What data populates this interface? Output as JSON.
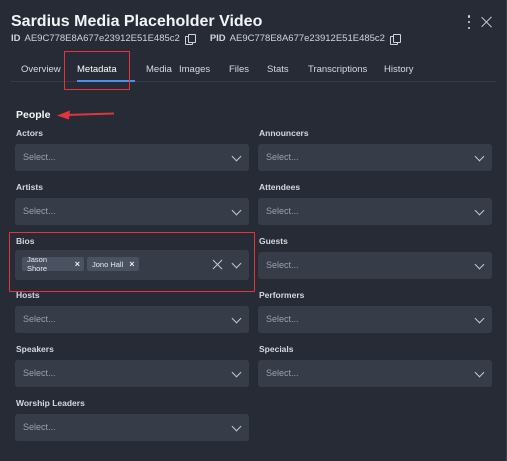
{
  "header": {
    "title": "Sardius Media Placeholder Video",
    "id_label": "ID",
    "id_value": "AE9C778E8A677e23912E51E485c2",
    "pid_label": "PID",
    "pid_value": "AE9C778E8A677e23912E51E485c2"
  },
  "tabs": [
    {
      "label": "Overview"
    },
    {
      "label": "Metadata"
    },
    {
      "label": "Media"
    },
    {
      "label": "Images"
    },
    {
      "label": "Files"
    },
    {
      "label": "Stats"
    },
    {
      "label": "Transcriptions"
    },
    {
      "label": "History"
    }
  ],
  "active_tab": "Metadata",
  "section_title": "People",
  "placeholder": "Select...",
  "fields": {
    "actors": {
      "label": "Actors"
    },
    "announcers": {
      "label": "Announcers"
    },
    "artists": {
      "label": "Artists"
    },
    "attendees": {
      "label": "Attendees"
    },
    "bios": {
      "label": "Bios",
      "selected": [
        "Jason Shore",
        "Jono Hall"
      ]
    },
    "guests": {
      "label": "Guests"
    },
    "hosts": {
      "label": "Hosts"
    },
    "performers": {
      "label": "Performers"
    },
    "speakers": {
      "label": "Speakers"
    },
    "specials": {
      "label": "Specials"
    },
    "worship_leaders": {
      "label": "Worship Leaders"
    }
  },
  "colors": {
    "background": "#262b36",
    "field": "#363c48",
    "accent": "#4e8ff0",
    "highlight": "#e2353b"
  }
}
